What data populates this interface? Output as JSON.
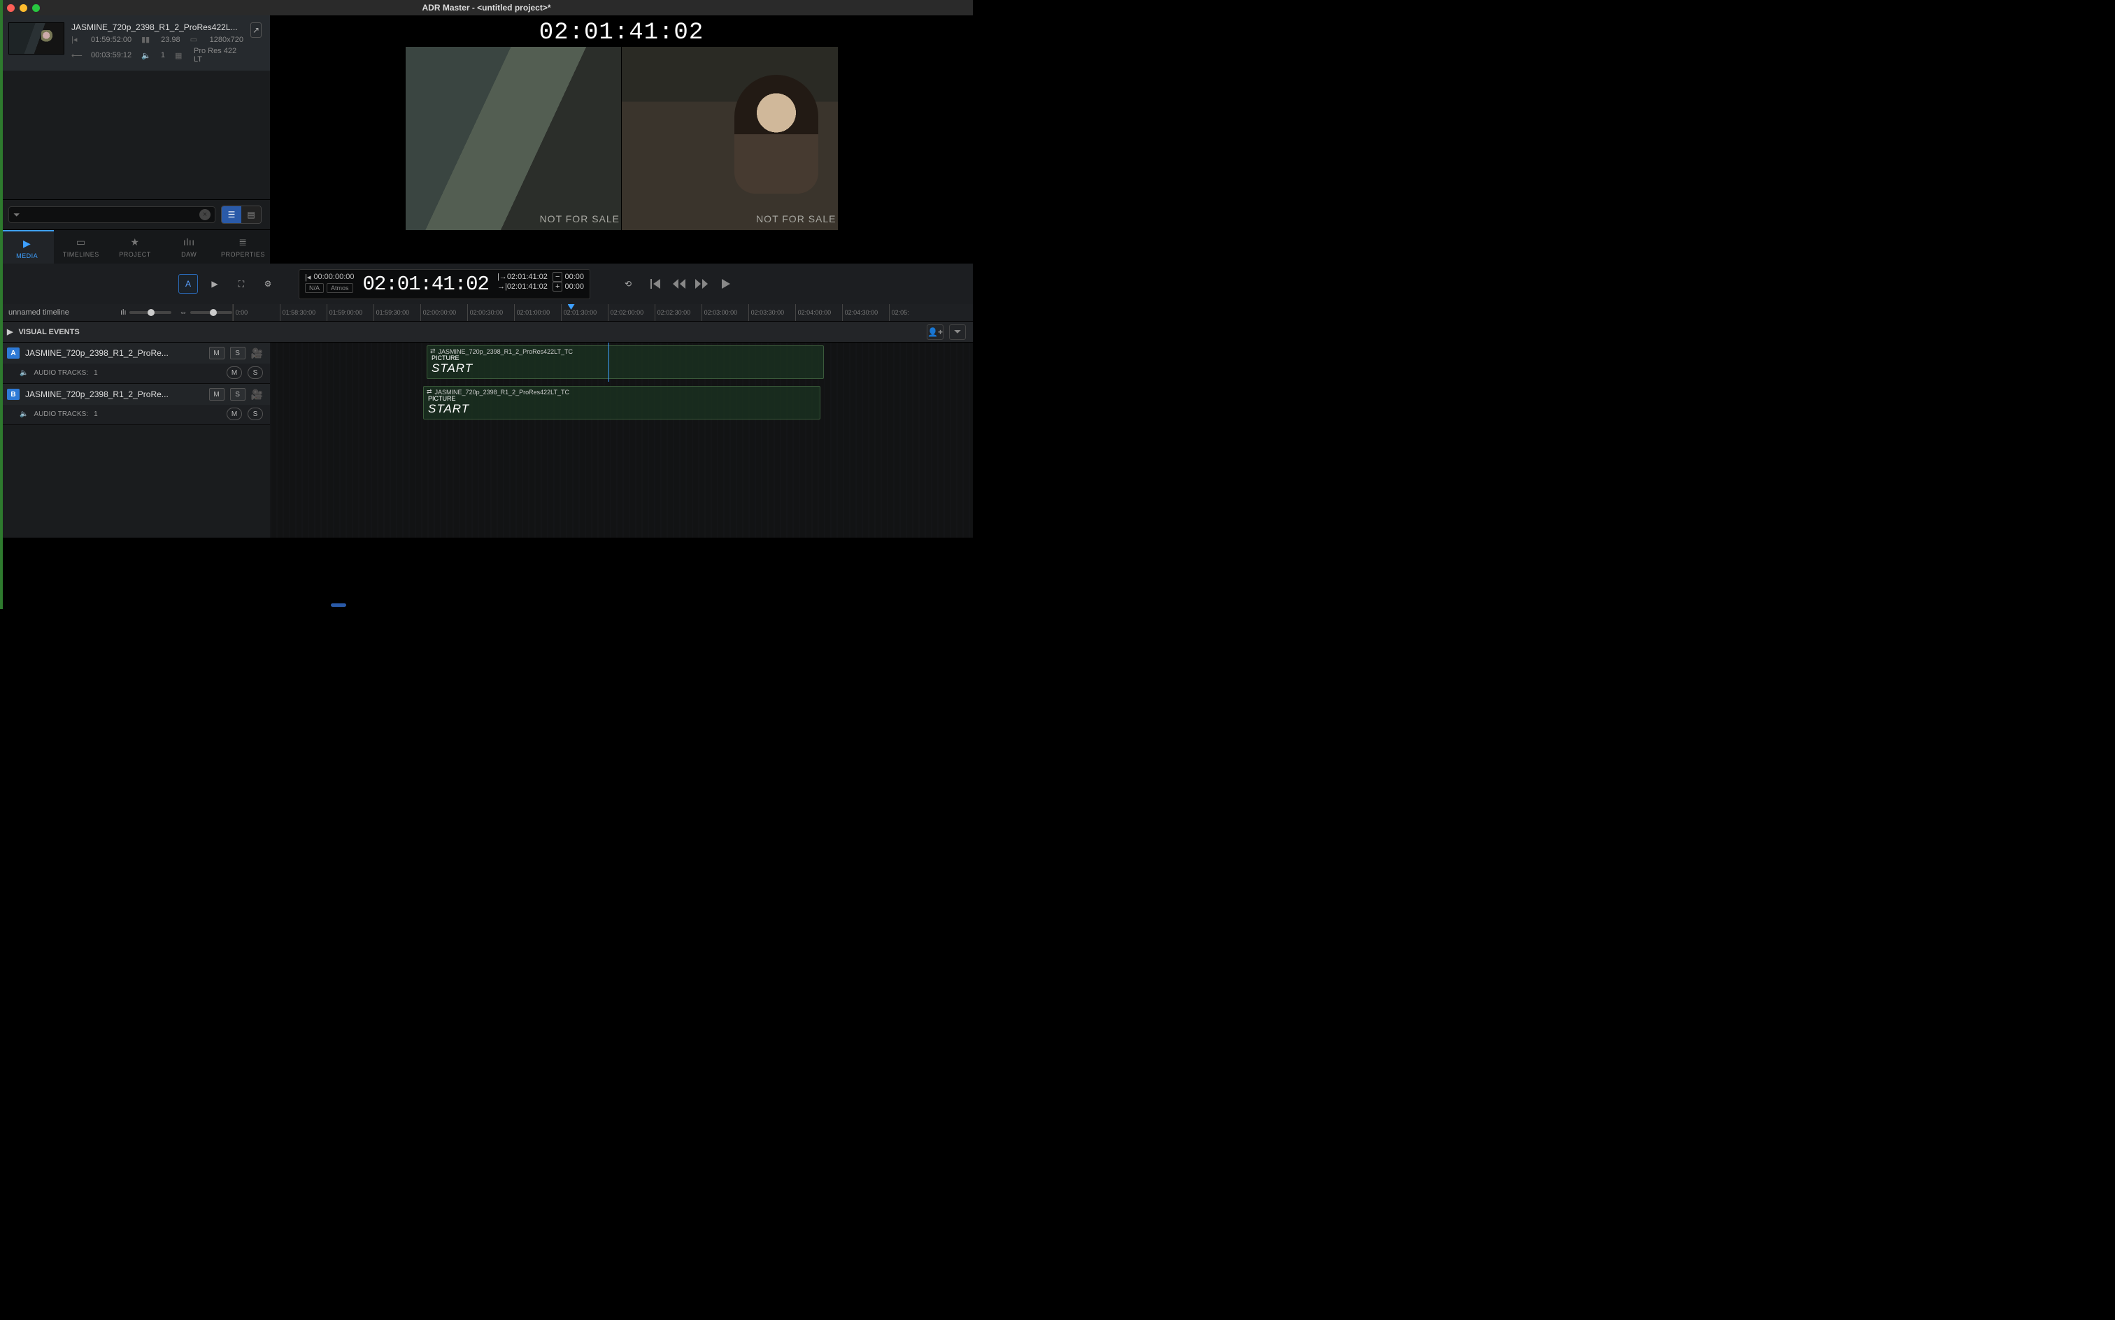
{
  "window": {
    "title": "ADR Master - <untitled project>*"
  },
  "media": {
    "clip_name": "JASMINE_720p_2398_R1_2_ProRes422L...",
    "start_tc": "01:59:52:00",
    "fps": "23.98",
    "resolution": "1280x720",
    "duration": "00:03:59:12",
    "channels": "1",
    "codec": "Pro Res 422 LT"
  },
  "tabs": {
    "media": "MEDIA",
    "timelines": "TIMELINES",
    "project": "PROJECT",
    "daw": "DAW",
    "properties": "PROPERTIES"
  },
  "viewer": {
    "tc": "02:01:41:02",
    "watermark": "NOT FOR SALE"
  },
  "transport": {
    "in_tc": "00:00:00:00",
    "mode1": "N/A",
    "mode2": "Atmos",
    "main_tc": "02:01:41:02",
    "in_mark": "02:01:41:02",
    "out_mark": "02:01:41:02",
    "dur1": "00:00",
    "dur2": "00:00"
  },
  "timeline": {
    "name": "unnamed timeline",
    "visual_events": "VISUAL EVENTS",
    "ruler_ticks": [
      "0:00",
      "01:58:30:00",
      "01:59:00:00",
      "01:59:30:00",
      "02:00:00:00",
      "02:00:30:00",
      "02:01:00:00",
      "02:01:30:00",
      "02:02:00:00",
      "02:02:30:00",
      "02:03:00:00",
      "02:03:30:00",
      "02:04:00:00",
      "02:04:30:00",
      "02:05:"
    ]
  },
  "tracks": [
    {
      "badge": "A",
      "name": "JASMINE_720p_2398_R1_2_ProRe...",
      "audio_label": "AUDIO TRACKS:",
      "audio_count": "1",
      "clip_label": "JASMINE_720p_2398_R1_2_ProRes422LT_TC",
      "start_small": "PICTURE",
      "start_big": "START"
    },
    {
      "badge": "B",
      "name": "JASMINE_720p_2398_R1_2_ProRe...",
      "audio_label": "AUDIO TRACKS:",
      "audio_count": "1",
      "clip_label": "JASMINE_720p_2398_R1_2_ProRes422LT_TC",
      "start_small": "PICTURE",
      "start_big": "START"
    }
  ]
}
